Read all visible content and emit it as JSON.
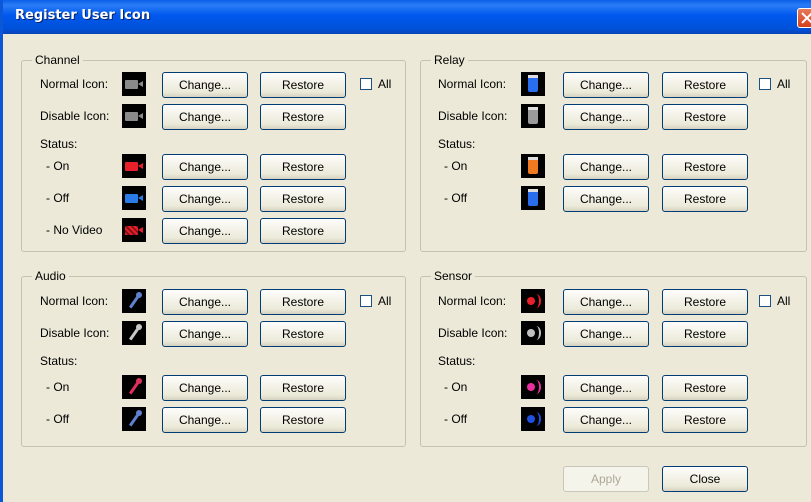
{
  "window": {
    "title": "Register User Icon"
  },
  "labels": {
    "normal": "Normal Icon:",
    "disable": "Disable Icon:",
    "status": "Status:",
    "on": "- On",
    "off": "- Off",
    "novideo": "- No Video",
    "change": "Change...",
    "restore": "Restore",
    "all": "All"
  },
  "groups": {
    "channel": "Channel",
    "relay": "Relay",
    "audio": "Audio",
    "sensor": "Sensor"
  },
  "footer": {
    "apply": "Apply",
    "close": "Close"
  },
  "icons": {
    "channel": {
      "normal": "camera-gray-icon",
      "disable": "camera-gray-icon",
      "on": "camera-red-icon",
      "off": "camera-blue-icon",
      "novideo": "camera-red-striped-icon"
    },
    "relay": {
      "normal": "relay-blue-icon",
      "disable": "relay-gray-icon",
      "on": "relay-orange-icon",
      "off": "relay-blue-icon"
    },
    "audio": {
      "normal": "microphone-blue-icon",
      "disable": "microphone-gray-icon",
      "on": "microphone-red-icon",
      "off": "microphone-blue-icon"
    },
    "sensor": {
      "normal": "sensor-red-icon",
      "disable": "sensor-gray-icon",
      "on": "sensor-pink-icon",
      "off": "sensor-blue-icon"
    }
  },
  "colors": {
    "titlebar": "#0058ee",
    "background": "#ece9d8",
    "camera_gray": "#8a8a8a",
    "camera_red": "#e8202a",
    "camera_blue": "#2a7be8",
    "relay_blue": "#2a6ef0",
    "relay_gray": "#9a9a9a",
    "relay_orange": "#f07a20",
    "mic_blue": "#6080d0",
    "mic_gray": "#c8c8c8",
    "mic_red": "#e03060",
    "sensor_red": "#e8202a",
    "sensor_gray": "#c0c0c0",
    "sensor_pink": "#e830a0",
    "sensor_blue": "#2050e0"
  }
}
